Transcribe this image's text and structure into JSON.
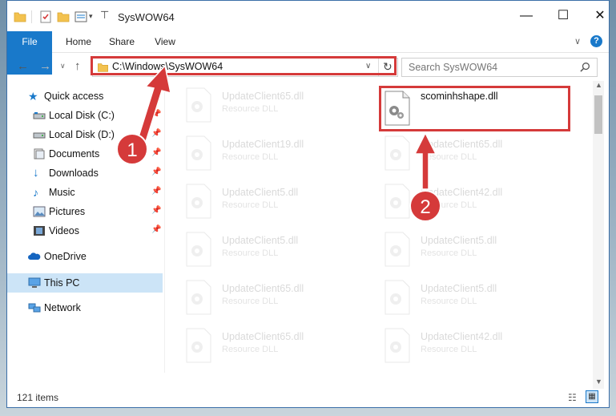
{
  "window": {
    "title": "SysWOW64",
    "controls": {
      "minimize": "—",
      "maximize": "☐",
      "close": "✕"
    }
  },
  "ribbon": {
    "tabs": [
      "File",
      "Home",
      "Share",
      "View"
    ]
  },
  "address_bar": {
    "path": "C:\\Windows\\SysWOW64",
    "search_placeholder": "Search SysWOW64"
  },
  "sidebar": {
    "items": [
      {
        "label": "Quick access",
        "icon": "star-icon",
        "pinned": false
      },
      {
        "label": "Local Disk (C:)",
        "icon": "drive-icon",
        "pinned": true
      },
      {
        "label": "Local Disk (D:)",
        "icon": "drive-icon",
        "pinned": true
      },
      {
        "label": "Documents",
        "icon": "documents-icon",
        "pinned": true
      },
      {
        "label": "Downloads",
        "icon": "download-icon",
        "pinned": true
      },
      {
        "label": "Music",
        "icon": "music-icon",
        "pinned": true
      },
      {
        "label": "Pictures",
        "icon": "pictures-icon",
        "pinned": true
      },
      {
        "label": "Videos",
        "icon": "videos-icon",
        "pinned": true
      },
      {
        "label": "OneDrive",
        "icon": "cloud-icon",
        "pinned": false
      },
      {
        "label": "This PC",
        "icon": "computer-icon",
        "pinned": false,
        "selected": true
      },
      {
        "label": "Network",
        "icon": "network-icon",
        "pinned": false
      }
    ]
  },
  "files": {
    "left_column": [
      {
        "name": "UpdateClient65.dll",
        "type": "Resource DLL"
      },
      {
        "name": "UpdateClient19.dll",
        "type": "Resource DLL"
      },
      {
        "name": "UpdateClient5.dll",
        "type": "Resource DLL"
      },
      {
        "name": "UpdateClient5.dll",
        "type": "Resource DLL"
      },
      {
        "name": "UpdateClient65.dll",
        "type": "Resource DLL"
      },
      {
        "name": "UpdateClient65.dll",
        "type": "Resource DLL"
      }
    ],
    "right_column": [
      {
        "name": "scominhshape.dll",
        "type": "",
        "highlighted": true
      },
      {
        "name": "UpdateClient65.dll",
        "type": "Resource DLL"
      },
      {
        "name": "UpdateClient42.dll",
        "type": "Resource DLL"
      },
      {
        "name": "UpdateClient5.dll",
        "type": "Resource DLL"
      },
      {
        "name": "UpdateClient5.dll",
        "type": "Resource DLL"
      },
      {
        "name": "UpdateClient42.dll",
        "type": "Resource DLL"
      }
    ]
  },
  "status": {
    "item_count": "121 items"
  },
  "annotations": {
    "step1": "1",
    "step2": "2",
    "color": "#d53a3a"
  }
}
